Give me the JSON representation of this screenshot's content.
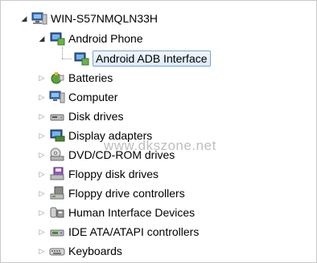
{
  "tree": {
    "root": {
      "label": "WIN-S57NMQLN33H",
      "icon": "computer-icon",
      "expanded": true
    },
    "android": {
      "label": "Android Phone",
      "icon": "android-phone-icon",
      "expanded": true
    },
    "adb": {
      "label": "Android ADB Interface",
      "icon": "adb-interface-icon",
      "selected": true
    },
    "items": [
      {
        "label": "Batteries",
        "icon": "battery-icon"
      },
      {
        "label": "Computer",
        "icon": "computer-icon"
      },
      {
        "label": "Disk drives",
        "icon": "disk-drive-icon"
      },
      {
        "label": "Display adapters",
        "icon": "display-adapter-icon"
      },
      {
        "label": "DVD/CD-ROM drives",
        "icon": "dvd-drive-icon"
      },
      {
        "label": "Floppy disk drives",
        "icon": "floppy-disk-icon"
      },
      {
        "label": "Floppy drive controllers",
        "icon": "floppy-controller-icon"
      },
      {
        "label": "Human Interface Devices",
        "icon": "hid-icon"
      },
      {
        "label": "IDE ATA/ATAPI controllers",
        "icon": "ide-controller-icon"
      },
      {
        "label": "Keyboards",
        "icon": "keyboard-icon"
      }
    ]
  },
  "watermark": "www.dkszone.net",
  "colors": {
    "selection_border": "#7da2ce",
    "selection_fill": "#dcebfc"
  }
}
